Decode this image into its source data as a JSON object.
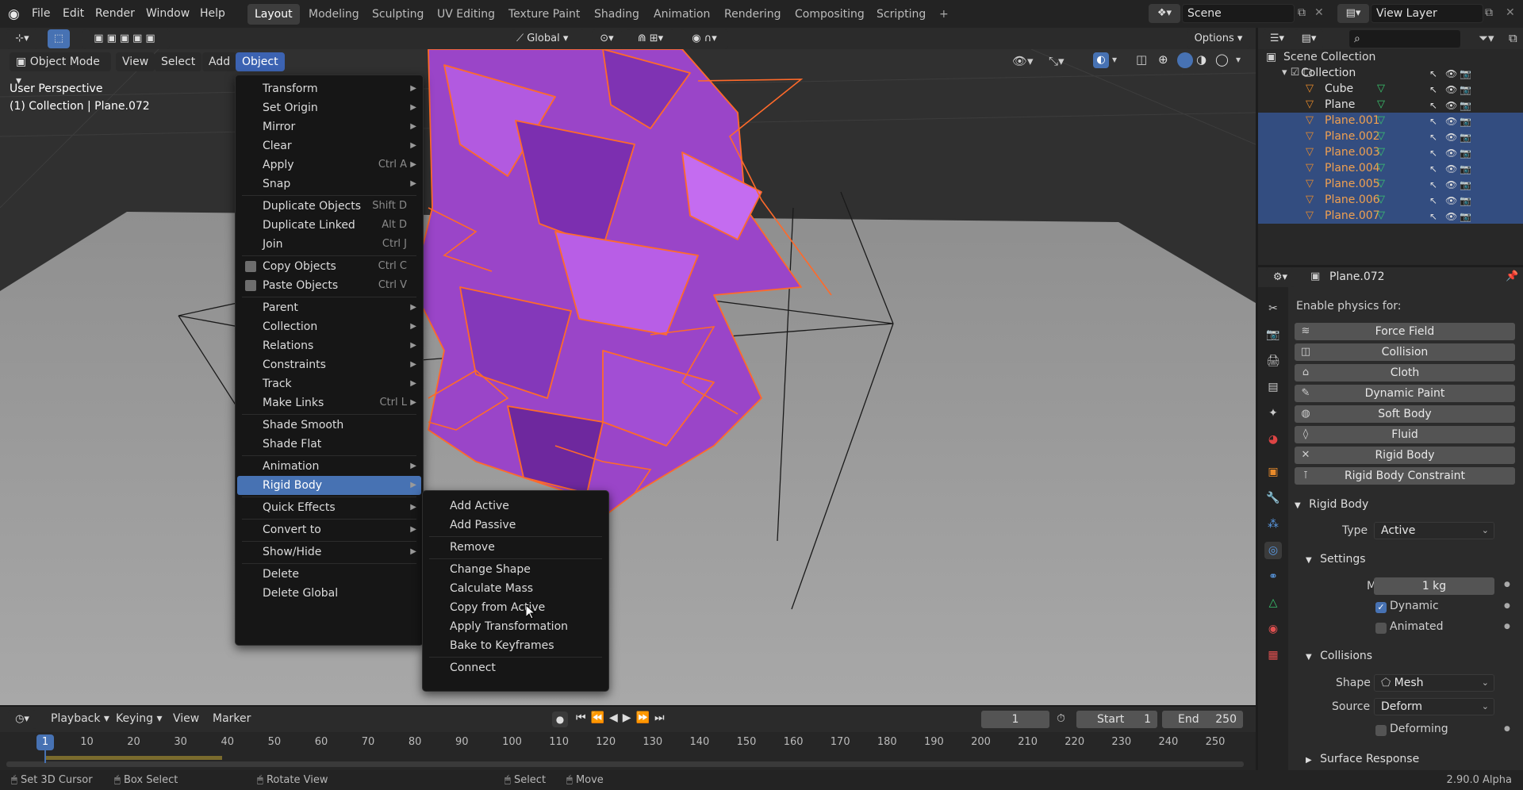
{
  "topbar": {
    "menus": [
      "File",
      "Edit",
      "Render",
      "Window",
      "Help"
    ],
    "workspaces": [
      {
        "label": "Layout",
        "active": true
      },
      {
        "label": "Modeling"
      },
      {
        "label": "Sculpting"
      },
      {
        "label": "UV Editing"
      },
      {
        "label": "Texture Paint"
      },
      {
        "label": "Shading"
      },
      {
        "label": "Animation"
      },
      {
        "label": "Rendering"
      },
      {
        "label": "Compositing"
      },
      {
        "label": "Scripting"
      }
    ],
    "add_workspace": "+",
    "scene_value": "Scene",
    "view_layer_value": "View Layer"
  },
  "toolbar": {
    "transform_orientation": "Global",
    "options_label": "Options"
  },
  "viewport": {
    "header": {
      "mode": "Object Mode",
      "menus": [
        "View",
        "Select",
        "Add",
        "Object"
      ],
      "active_menu": "Object"
    },
    "overlay_line1": "User Perspective",
    "overlay_line2": "(1) Collection | Plane.072"
  },
  "object_menu": {
    "items": [
      {
        "label": "Transform",
        "submenu": true
      },
      {
        "label": "Set Origin",
        "submenu": true
      },
      {
        "label": "Mirror",
        "submenu": true
      },
      {
        "label": "Clear",
        "submenu": true
      },
      {
        "label": "Apply",
        "shortcut": "Ctrl A",
        "submenu": true
      },
      {
        "label": "Snap",
        "submenu": true
      },
      {
        "sep": true
      },
      {
        "label": "Duplicate Objects",
        "shortcut": "Shift D"
      },
      {
        "label": "Duplicate Linked",
        "shortcut": "Alt D"
      },
      {
        "label": "Join",
        "shortcut": "Ctrl J"
      },
      {
        "sep": true
      },
      {
        "label": "Copy Objects",
        "shortcut": "Ctrl C",
        "icon": true
      },
      {
        "label": "Paste Objects",
        "shortcut": "Ctrl V",
        "icon": true
      },
      {
        "sep": true
      },
      {
        "label": "Parent",
        "submenu": true
      },
      {
        "label": "Collection",
        "submenu": true
      },
      {
        "label": "Relations",
        "submenu": true
      },
      {
        "label": "Constraints",
        "submenu": true
      },
      {
        "label": "Track",
        "submenu": true
      },
      {
        "label": "Make Links",
        "shortcut": "Ctrl L",
        "submenu": true
      },
      {
        "sep": true
      },
      {
        "label": "Shade Smooth"
      },
      {
        "label": "Shade Flat"
      },
      {
        "sep": true
      },
      {
        "label": "Animation",
        "submenu": true
      },
      {
        "label": "Rigid Body",
        "submenu": true,
        "highlight": true
      },
      {
        "sep": true
      },
      {
        "label": "Quick Effects",
        "submenu": true
      },
      {
        "sep": true
      },
      {
        "label": "Convert to",
        "submenu": true
      },
      {
        "sep": true
      },
      {
        "label": "Show/Hide",
        "submenu": true
      },
      {
        "sep": true
      },
      {
        "label": "Delete"
      },
      {
        "label": "Delete Global"
      }
    ]
  },
  "rigid_body_menu": {
    "items": [
      {
        "label": "Add Active"
      },
      {
        "label": "Add Passive"
      },
      {
        "sep": true
      },
      {
        "label": "Remove"
      },
      {
        "sep": true
      },
      {
        "label": "Change Shape"
      },
      {
        "label": "Calculate Mass"
      },
      {
        "label": "Copy from Active"
      },
      {
        "label": "Apply Transformation"
      },
      {
        "label": "Bake to Keyframes"
      },
      {
        "sep": true
      },
      {
        "label": "Connect"
      }
    ]
  },
  "outliner": {
    "root": "Scene Collection",
    "collection": "Collection",
    "items": [
      {
        "label": "Cube",
        "selected": false
      },
      {
        "label": "Plane",
        "selected": false
      },
      {
        "label": "Plane.001",
        "selected": true
      },
      {
        "label": "Plane.002",
        "selected": true
      },
      {
        "label": "Plane.003",
        "selected": true
      },
      {
        "label": "Plane.004",
        "selected": true
      },
      {
        "label": "Plane.005",
        "selected": true
      },
      {
        "label": "Plane.006",
        "selected": true
      },
      {
        "label": "Plane.007",
        "selected": true
      }
    ]
  },
  "properties": {
    "object_name": "Plane.072",
    "enable_physics_label": "Enable physics for:",
    "physics_buttons": [
      {
        "label": "Force Field",
        "icon": "≋"
      },
      {
        "label": "Collision",
        "icon": "◫"
      },
      {
        "label": "Cloth",
        "icon": "⌂"
      },
      {
        "label": "Dynamic Paint",
        "icon": "✎"
      },
      {
        "label": "Soft Body",
        "icon": "◍"
      },
      {
        "label": "Fluid",
        "icon": "◊"
      },
      {
        "label": "Rigid Body",
        "icon": "✕"
      },
      {
        "label": "Rigid Body Constraint",
        "icon": "⊺"
      }
    ],
    "rigid_body": {
      "header": "Rigid Body",
      "type_label": "Type",
      "type_value": "Active",
      "settings_header": "Settings",
      "mass_label": "Mass",
      "mass_value": "1 kg",
      "dynamic_label": "Dynamic",
      "dynamic_checked": true,
      "animated_label": "Animated",
      "animated_checked": false,
      "collisions_header": "Collisions",
      "shape_label": "Shape",
      "shape_value": "Mesh",
      "source_label": "Source",
      "source_value": "Deform",
      "deforming_label": "Deforming",
      "surface_response_header": "Surface Response"
    }
  },
  "timeline": {
    "menus": [
      "Playback",
      "Keying",
      "View",
      "Marker"
    ],
    "current_frame": "1",
    "start_label": "Start",
    "start_value": "1",
    "end_label": "End",
    "end_value": "250",
    "ticks": [
      "10",
      "20",
      "30",
      "40",
      "50",
      "60",
      "70",
      "80",
      "90",
      "100",
      "110",
      "120",
      "130",
      "140",
      "150",
      "160",
      "170",
      "180",
      "190",
      "200",
      "210",
      "220",
      "230",
      "240",
      "250"
    ],
    "playhead_label": "1"
  },
  "statusbar": {
    "hints": [
      "Set 3D Cursor",
      "Box Select",
      "Rotate View",
      "Select",
      "Move"
    ],
    "version": "2.90.0 Alpha"
  }
}
